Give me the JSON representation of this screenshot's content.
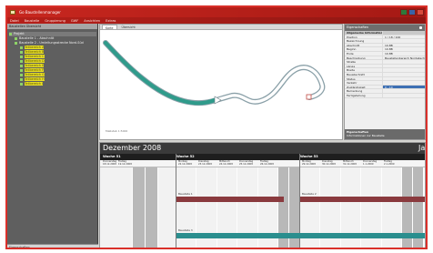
{
  "window": {
    "title": "Go Baustellenmanager",
    "controls": [
      "minimize",
      "maximize",
      "close"
    ],
    "colors": {
      "titlebar": "#c8271f",
      "frame": "#d9302a",
      "accent": "#2c8a8a"
    }
  },
  "menu": [
    "Datei",
    "Baustelle",
    "Gruppierung",
    "GWF",
    "Ansichten",
    "Extras"
  ],
  "left_panel": {
    "header": "Baustellen Übersicht",
    "tree": [
      {
        "label": "Projekt",
        "level": 0
      },
      {
        "label": "Baustelle 1 - Abschnitt",
        "level": 1
      },
      {
        "label": "Baustelle 2 - Umleitungsstrecke Nord-Süd",
        "level": 1
      },
      {
        "label": "Teilbereich A",
        "level": 2
      },
      {
        "label": "Teilbereich B",
        "level": 2
      },
      {
        "label": "Teilbereich C",
        "level": 2
      },
      {
        "label": "Teilbereich D",
        "level": 2
      },
      {
        "label": "Teilbereich E",
        "level": 2
      },
      {
        "label": "Teilbereich F",
        "level": 2
      },
      {
        "label": "Teilbereich G",
        "level": 2
      },
      {
        "label": "Teilbereich H",
        "level": 2
      },
      {
        "label": "Teilbereich I",
        "level": 2
      }
    ],
    "footer": "Eigenschaften"
  },
  "map": {
    "tabs": [
      "Karte",
      "Übersicht"
    ],
    "footer": "Maßstab 1:5000",
    "route_color": "#2f9b8b"
  },
  "properties": {
    "header": "Eigenschaften",
    "rows": [
      {
        "k": "Allgemeine Information",
        "v": "",
        "group": true
      },
      {
        "k": "Position",
        "v": "1 / 18 / 100"
      },
      {
        "k": "Bezeichnung",
        "v": ""
      },
      {
        "k": "Abschnitt",
        "v": "10.8B"
      },
      {
        "k": "Beginn",
        "v": "10.8B"
      },
      {
        "k": "Ende",
        "v": "10.8B"
      },
      {
        "k": "Beschreibung",
        "v": "Baustellenbereich Nordabschnitt"
      },
      {
        "k": "Straße",
        "v": ""
      },
      {
        "k": "Länge",
        "v": ""
      },
      {
        "k": "Breite",
        "v": ""
      },
      {
        "k": "Bauabschnitt",
        "v": ""
      },
      {
        "k": "Status",
        "v": ""
      },
      {
        "k": "Verkehr",
        "v": ""
      },
      {
        "k": "Zuständigkeit",
        "v": "0 - 10",
        "sel": true
      },
      {
        "k": "Bemerkung",
        "v": ""
      },
      {
        "k": "Fertigstellung",
        "v": ""
      }
    ],
    "description_title": "Eigenschaften",
    "description_text": "Informationen zur Baustelle"
  },
  "calendar": {
    "month": "Dezember 2008",
    "next_month": "Ja",
    "weeks": [
      "Woche 51",
      "Woche 52",
      "Woche 53"
    ],
    "days": [
      "Donnerstag\n18.12.2008",
      "Freitag\n19.12.2008",
      "Montag\n22.12.2008",
      "Dienstag\n23.12.2008",
      "Mittwoch\n24.12.2008",
      "Donnerstag\n25.12.2008",
      "Freitag\n26.12.2008",
      "Montag\n29.12.2008",
      "Dienstag\n30.12.2008",
      "Mittwoch\n31.12.2008",
      "Donnerstag\n1.1.2009",
      "Freitag\n2.1.2009"
    ],
    "events": [
      {
        "label": "Baustelle 1",
        "color": "#8a3a3e"
      },
      {
        "label": "Baustelle 2",
        "color": "#8a3a3e"
      },
      {
        "label": "Baustelle 3",
        "color": "#2a8e8e"
      }
    ]
  }
}
